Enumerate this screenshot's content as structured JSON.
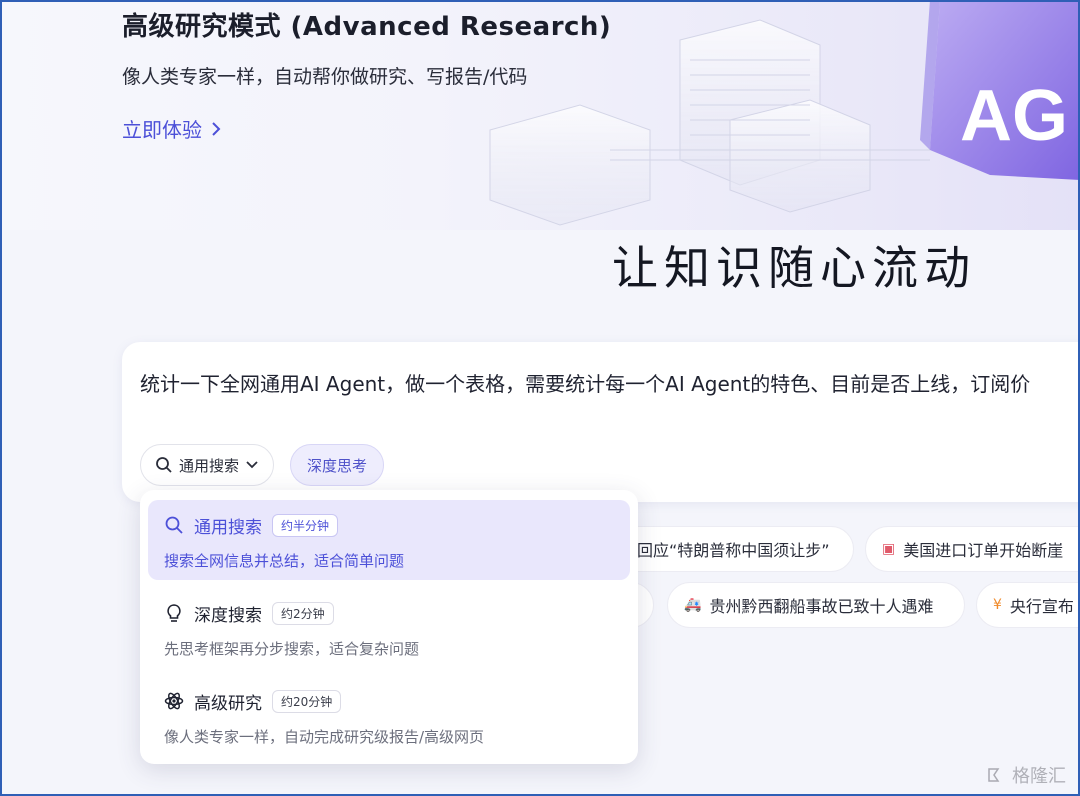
{
  "hero": {
    "title": "高级研究模式 (Advanced Research)",
    "subtitle": "像人类专家一样，自动帮你做研究、写报告/代码",
    "cta": "立即体验",
    "art_text": "AG"
  },
  "main_title": "让知识随心流动",
  "input": {
    "value": "统计一下全网通用AI Agent，做一个表格，需要统计每一个AI Agent的特色、目前是否上线，订阅价"
  },
  "toolbar": {
    "mode_label": "通用搜索",
    "deep_label": "深度思考"
  },
  "chips": [
    {
      "text": "回应“特朗普称中国须让步”"
    },
    {
      "text": "美国进口订单开始断崖"
    },
    {
      "text": "贵州黔西翻船事故已致十人遇难"
    },
    {
      "text": "央行宣布"
    }
  ],
  "dropdown": {
    "options": [
      {
        "name": "通用搜索",
        "time": "约半分钟",
        "desc": "搜索全网信息并总结，适合简单问题"
      },
      {
        "name": "深度搜索",
        "time": "约2分钟",
        "desc": "先思考框架再分步搜索，适合复杂问题"
      },
      {
        "name": "高级研究",
        "time": "约20分钟",
        "desc": "像人类专家一样，自动完成研究级报告/高级网页"
      }
    ]
  },
  "watermark": "格隆汇",
  "colors": {
    "accent": "#4c50d8",
    "active_bg": "#e9e7fc",
    "frame": "#2f5fb6"
  }
}
